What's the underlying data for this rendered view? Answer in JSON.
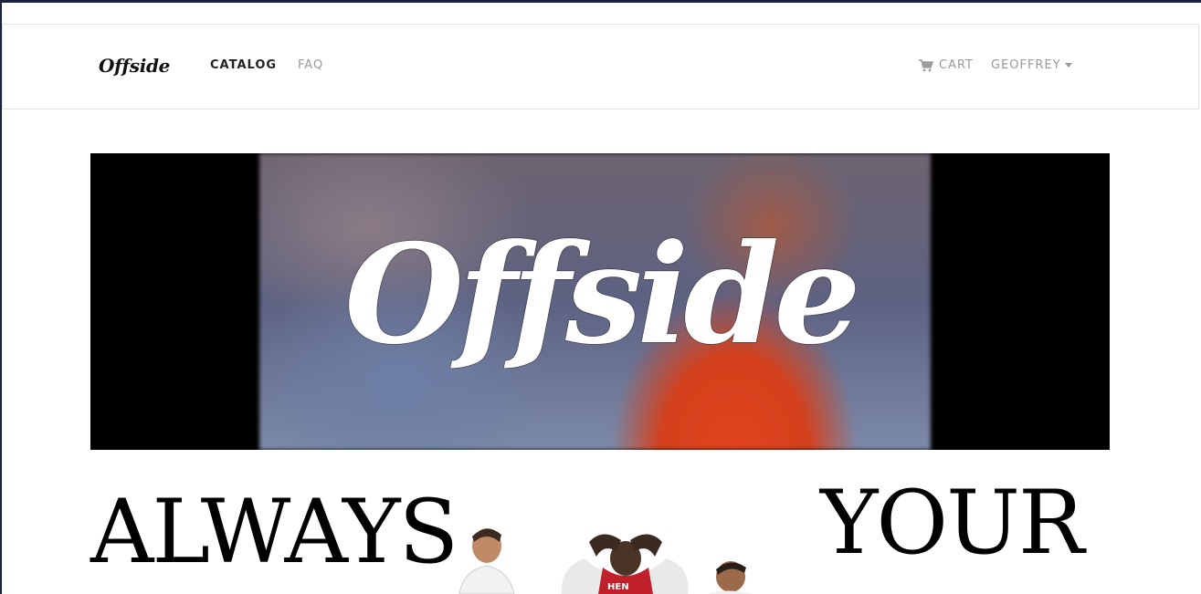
{
  "navbar": {
    "brand": "Offside",
    "links": [
      {
        "label": "CATALOG",
        "active": true
      },
      {
        "label": "FAQ",
        "active": false
      }
    ],
    "cart_label": "CART",
    "user_label": "GEOFFREY"
  },
  "hero": {
    "title": "Offside"
  },
  "tagline": {
    "left_word": "ALWAYS",
    "right_word": "YOUR"
  },
  "colors": {
    "nav_muted": "#9a9a9a",
    "nav_active": "#222222",
    "hero_background": "#000000",
    "frame": "#1b2240"
  },
  "icons": {
    "cart": "shopping-cart-icon",
    "caret": "caret-down-icon"
  }
}
